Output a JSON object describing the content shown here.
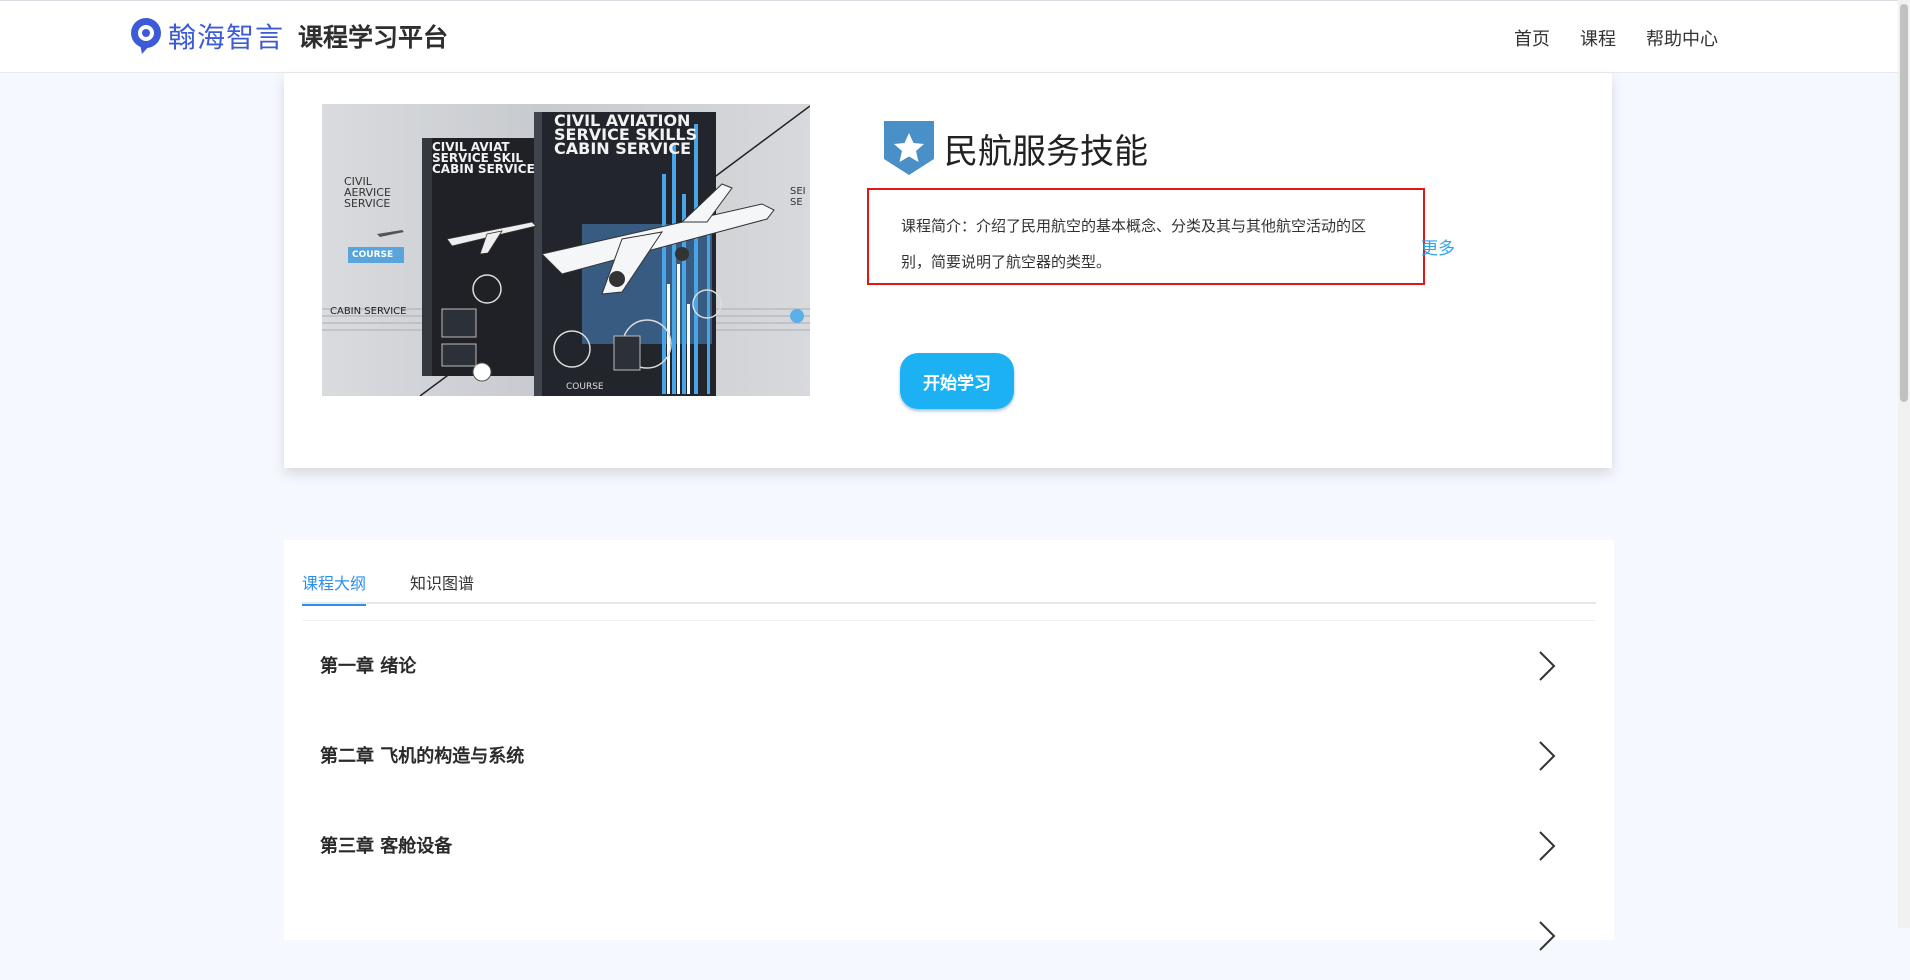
{
  "header": {
    "brand_name": "翰海智言",
    "brand_subtitle": "课程学习平台",
    "nav": [
      "首页",
      "课程",
      "帮助中心"
    ]
  },
  "course": {
    "title": "民航服务技能",
    "intro": "课程简介：介绍了民用航空的基本概念、分类及其与其他航空活动的区别，简要说明了航空器的类型。",
    "more_label": "更多",
    "start_label": "开始学习",
    "cover": {
      "title_line1": "CIVIL AVIATION",
      "title_line2": "SERVICE SKILLS",
      "title_line3": "CABIN SERVICE",
      "back_line1": "CIVIL AVIAT",
      "back_line2": "SERVICE SKIL",
      "back_line3": "CABIN SERVICE",
      "side_line1": "CIVIL",
      "side_line2": "AERVICE",
      "side_line3": "SERVICE",
      "badge": "COURSE",
      "cabin": "CABIN SERVICE",
      "course_bottom": "COURSE",
      "right_text": "SEI SE"
    }
  },
  "outline": {
    "tabs": [
      "课程大纲",
      "知识图谱"
    ],
    "chapters": [
      "第一章 绪论",
      "第二章 飞机的构造与系统",
      "第三章 客舱设备"
    ]
  },
  "colors": {
    "accent": "#2e8fe8",
    "brand": "#3d5bd6",
    "button": "#1cb1f2",
    "highlight_border": "#e01717"
  }
}
